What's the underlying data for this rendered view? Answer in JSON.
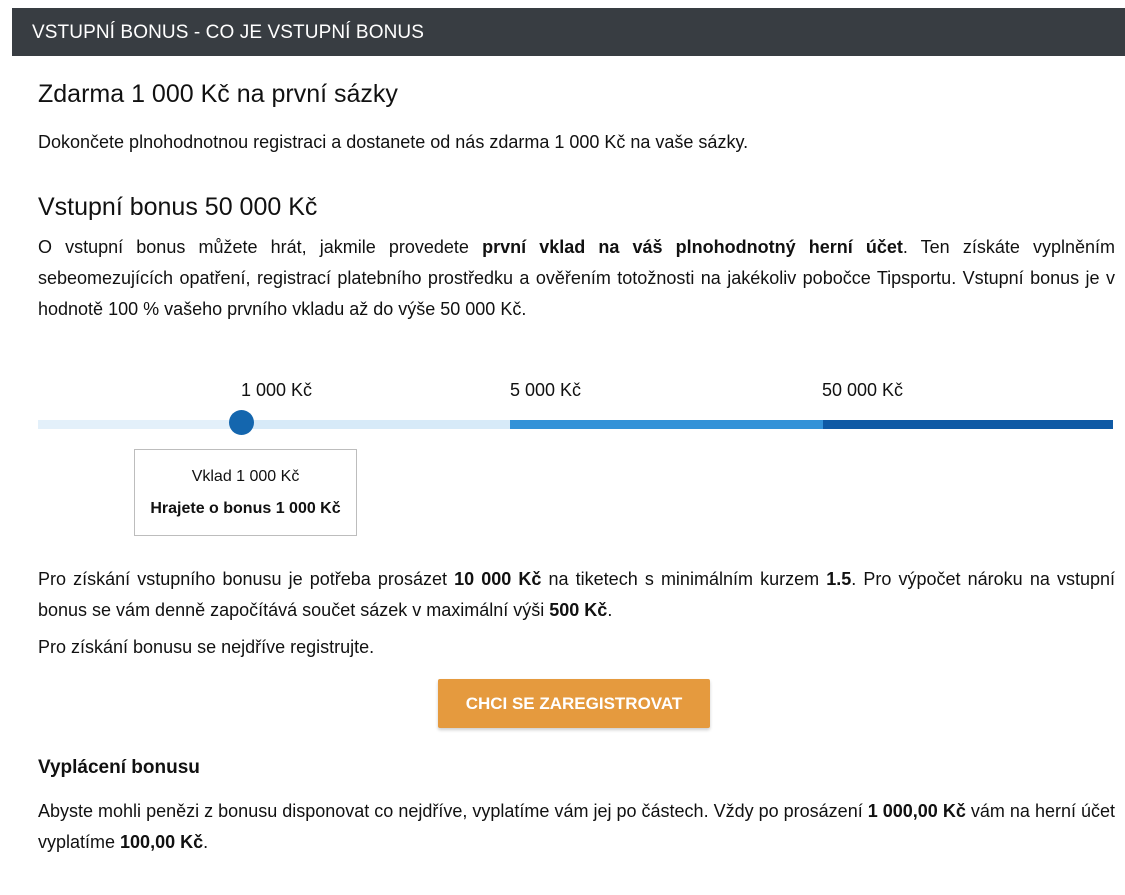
{
  "header": {
    "title": "VSTUPNÍ BONUS - CO JE VSTUPNÍ BONUS"
  },
  "free_bet": {
    "heading": "Zdarma 1 000 Kč na první sázky",
    "text": "Dokončete plnohodnotnou registraci a dostanete od nás zdarma 1 000 Kč na vaše sázky."
  },
  "entry_bonus": {
    "heading": "Vstupní bonus 50 000 Kč",
    "text_part1": "O vstupní bonus můžete hrát, jakmile provedete ",
    "text_bold": "první vklad na váš plnohodnotný herní účet",
    "text_part2": ". Ten získáte vyplněním sebeomezujících opatření, registrací platebního prostředku a ověřením totožnosti na jakékoliv pobočce Tipsportu. Vstupní bonus je v hodnotě 100 % vašeho prvního vkladu až do výše 50 000 Kč."
  },
  "slider": {
    "tiers": [
      "1 000 Kč",
      "5 000 Kč",
      "50 000 Kč"
    ],
    "selected_value": "1 000 Kč",
    "info_deposit": "Vklad 1 000 Kč",
    "info_bonus": "Hrajete o bonus 1 000 Kč",
    "colors": {
      "light": "#d7eaf8",
      "mid": "#3392d8",
      "dark": "#0f5aa5",
      "knob": "#1466ae"
    }
  },
  "conditions": {
    "part1": "Pro získání vstupního bonusu je potřeba prosázet ",
    "amount": "10 000 Kč",
    "part2": " na tiketech s minimálním kurzem ",
    "odds": "1.5",
    "part3": ". Pro výpočet nároku na vstupní bonus se vám denně započítává součet sázek v maximální výši ",
    "daily_max": "500 Kč",
    "part4": "."
  },
  "register_prompt": "Pro získání bonusu se nejdříve registrujte.",
  "cta": {
    "label": "CHCI SE ZAREGISTROVAT",
    "color": "#e59a3e"
  },
  "payout": {
    "heading": "Vyplácení bonusu",
    "part1": "Abyste mohli penězi z bonusu disponovat co nejdříve, vyplatíme vám jej po částech. Vždy po prosázení ",
    "stake": "1 000,00 Kč",
    "part2": " vám na herní účet vyplatíme ",
    "reward": "100,00 Kč",
    "part3": "."
  }
}
